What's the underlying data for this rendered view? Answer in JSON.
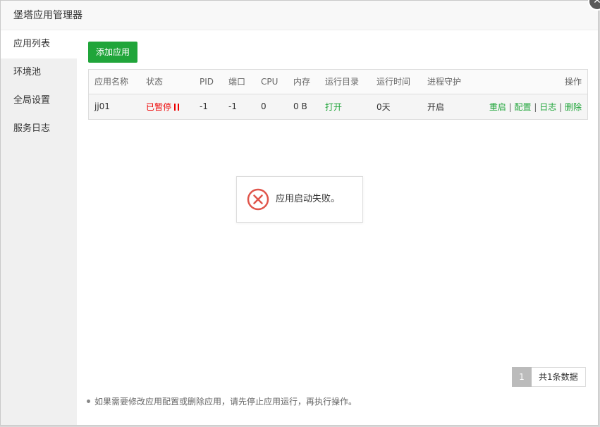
{
  "window": {
    "title": "堡塔应用管理器",
    "close_icon": "close-icon"
  },
  "sidebar": {
    "items": [
      {
        "label": "应用列表",
        "active": true
      },
      {
        "label": "环境池"
      },
      {
        "label": "全局设置"
      },
      {
        "label": "服务日志"
      }
    ]
  },
  "toolbar": {
    "add_label": "添加应用",
    "add_color": "#20a53a"
  },
  "table": {
    "headers": [
      "应用名称",
      "状态",
      "PID",
      "端口",
      "CPU",
      "内存",
      "运行目录",
      "运行时间",
      "进程守护",
      "操作"
    ],
    "rows": [
      {
        "name": "jj01",
        "status": "已暂停",
        "status_icon": "pause-icon",
        "pid": "-1",
        "port": "-1",
        "cpu": "0",
        "memory": "0 B",
        "run_dir": "打开",
        "run_time": "0天",
        "guard": "开启",
        "actions": {
          "restart": "重启",
          "config": "配置",
          "log": "日志",
          "delete": "删除",
          "separator": "|"
        }
      }
    ]
  },
  "toast": {
    "message": "应用启动失败。",
    "icon": "error-icon",
    "color": "#e0554b"
  },
  "pager": {
    "current": "1",
    "total_text": "共1条数据"
  },
  "hint": "如果需要修改应用配置或删除应用，请先停止应用运行，再执行操作。",
  "colors": {
    "accent": "#20a53a",
    "danger": "#ee0000"
  }
}
